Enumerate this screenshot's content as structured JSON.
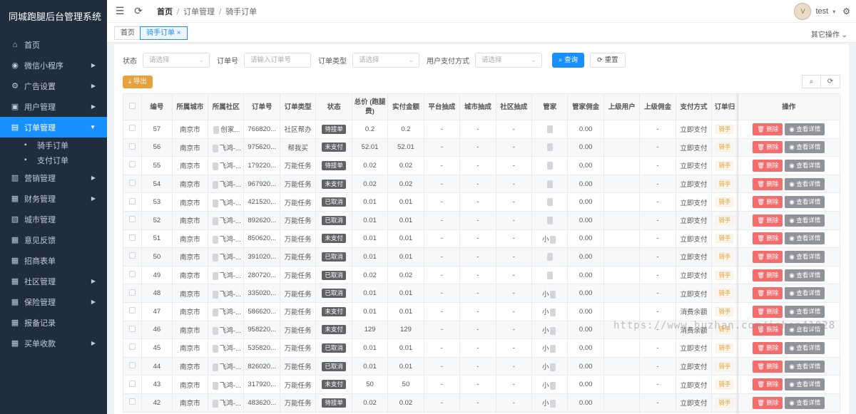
{
  "brand": "同城跑腿后台管理系统",
  "sidebar": {
    "items": [
      {
        "label": "首页",
        "icon": "home-icon",
        "glyph": "⌂",
        "arrow": false
      },
      {
        "label": "微信小程序",
        "icon": "wechat-icon",
        "glyph": "◉",
        "arrow": true
      },
      {
        "label": "广告设置",
        "icon": "ad-settings-icon",
        "glyph": "⚙",
        "arrow": true
      },
      {
        "label": "用户管理",
        "icon": "user-icon",
        "glyph": "▣",
        "arrow": true
      },
      {
        "label": "订单管理",
        "icon": "order-icon",
        "glyph": "▤",
        "arrow": true,
        "active": true
      },
      {
        "label": "骑手订单",
        "icon": "rider-order-icon",
        "glyph": "▪",
        "sub": true
      },
      {
        "label": "支付订单",
        "icon": "pay-order-icon",
        "glyph": "▪",
        "sub": true
      },
      {
        "label": "营销管理",
        "icon": "marketing-icon",
        "glyph": "▥",
        "arrow": true
      },
      {
        "label": "财务管理",
        "icon": "finance-icon",
        "glyph": "▦",
        "arrow": true
      },
      {
        "label": "城市管理",
        "icon": "city-icon",
        "glyph": "▧",
        "arrow": false
      },
      {
        "label": "意见反馈",
        "icon": "feedback-icon",
        "glyph": "▦",
        "arrow": false
      },
      {
        "label": "招商表单",
        "icon": "form-icon",
        "glyph": "▦",
        "arrow": false
      },
      {
        "label": "社区管理",
        "icon": "community-icon",
        "glyph": "▦",
        "arrow": true
      },
      {
        "label": "保险管理",
        "icon": "insurance-icon",
        "glyph": "▦",
        "arrow": true
      },
      {
        "label": "报备记录",
        "icon": "report-icon",
        "glyph": "▦",
        "arrow": false
      },
      {
        "label": "买单收款",
        "icon": "payment-icon",
        "glyph": "▦",
        "arrow": true
      }
    ]
  },
  "topbar": {
    "breadcrumb": [
      "首页",
      "订单管理",
      "骑手订单"
    ],
    "user": "test",
    "avatar_text": "V"
  },
  "tabs": [
    {
      "label": "首页",
      "active": false
    },
    {
      "label": "骑手订单",
      "active": true
    }
  ],
  "other_ops": "其它操作",
  "filters": {
    "status_label": "状态",
    "status_placeholder": "请选择",
    "order_no_label": "订单号",
    "order_no_placeholder": "请输入订单号",
    "order_type_label": "订单类型",
    "order_type_placeholder": "请选择",
    "pay_method_label": "用户支付方式",
    "pay_method_placeholder": "请选择",
    "search_btn": "查询",
    "reset_btn": "重置"
  },
  "export_btn": "导出",
  "table": {
    "headers": [
      "编号",
      "所属城市",
      "所属社区",
      "订单号",
      "订单类型",
      "状态",
      "总价 (跑腿费)",
      "实付金额",
      "平台抽成",
      "城市抽成",
      "社区抽成",
      "管家",
      "管家佣金",
      "上级用户",
      "上级佣金",
      "支付方式",
      "订单归",
      "操作"
    ],
    "del_label": "删除",
    "view_label": "查看详情",
    "rows": [
      {
        "id": "57",
        "city": "南京市",
        "community": "创家...",
        "order_no": "766820...",
        "type": "社区帮办",
        "status": "待接单",
        "total": "0.2",
        "paid": "0.2",
        "platform": "-",
        "city_cut": "-",
        "comm_cut": "-",
        "steward": "",
        "steward_fee": "0.00",
        "parent": "",
        "parent_fee": "-",
        "pay": "立即支付",
        "belong": "骑手"
      },
      {
        "id": "56",
        "city": "南京市",
        "community": "飞鸿-...",
        "order_no": "975620...",
        "type": "帮我买",
        "status": "未支付",
        "total": "52.01",
        "paid": "52.01",
        "platform": "-",
        "city_cut": "-",
        "comm_cut": "-",
        "steward": "",
        "steward_fee": "0.00",
        "parent": "",
        "parent_fee": "-",
        "pay": "立即支付",
        "belong": "骑手"
      },
      {
        "id": "55",
        "city": "南京市",
        "community": "飞鸿-...",
        "order_no": "179220...",
        "type": "万能任务",
        "status": "待接单",
        "total": "0.02",
        "paid": "0.02",
        "platform": "-",
        "city_cut": "-",
        "comm_cut": "-",
        "steward": "",
        "steward_fee": "0.00",
        "parent": "",
        "parent_fee": "-",
        "pay": "立即支付",
        "belong": "骑手"
      },
      {
        "id": "54",
        "city": "南京市",
        "community": "飞鸿-...",
        "order_no": "967920...",
        "type": "万能任务",
        "status": "未支付",
        "total": "0.02",
        "paid": "0.02",
        "platform": "-",
        "city_cut": "-",
        "comm_cut": "-",
        "steward": "",
        "steward_fee": "0.00",
        "parent": "",
        "parent_fee": "-",
        "pay": "立即支付",
        "belong": "骑手"
      },
      {
        "id": "53",
        "city": "南京市",
        "community": "飞鸿-...",
        "order_no": "421520...",
        "type": "万能任务",
        "status": "已取消",
        "total": "0.01",
        "paid": "0.01",
        "platform": "-",
        "city_cut": "-",
        "comm_cut": "-",
        "steward": "",
        "steward_fee": "0.00",
        "parent": "",
        "parent_fee": "-",
        "pay": "立即支付",
        "belong": "骑手"
      },
      {
        "id": "52",
        "city": "南京市",
        "community": "飞鸿-...",
        "order_no": "892620...",
        "type": "万能任务",
        "status": "已取消",
        "total": "0.01",
        "paid": "0.01",
        "platform": "-",
        "city_cut": "-",
        "comm_cut": "-",
        "steward": "",
        "steward_fee": "0.00",
        "parent": "",
        "parent_fee": "-",
        "pay": "立即支付",
        "belong": "骑手"
      },
      {
        "id": "51",
        "city": "南京市",
        "community": "飞鸿-...",
        "order_no": "850620...",
        "type": "万能任务",
        "status": "未支付",
        "total": "0.01",
        "paid": "0.01",
        "platform": "-",
        "city_cut": "-",
        "comm_cut": "-",
        "steward": "小",
        "steward_fee": "0.00",
        "parent": "",
        "parent_fee": "-",
        "pay": "立即支付",
        "belong": "骑手"
      },
      {
        "id": "50",
        "city": "南京市",
        "community": "飞鸿-...",
        "order_no": "391020...",
        "type": "万能任务",
        "status": "已取消",
        "total": "0.01",
        "paid": "0.01",
        "platform": "-",
        "city_cut": "-",
        "comm_cut": "-",
        "steward": "",
        "steward_fee": "0.00",
        "parent": "",
        "parent_fee": "-",
        "pay": "立即支付",
        "belong": "骑手"
      },
      {
        "id": "49",
        "city": "南京市",
        "community": "飞鸿-...",
        "order_no": "280720...",
        "type": "万能任务",
        "status": "已取消",
        "total": "0.02",
        "paid": "0.02",
        "platform": "-",
        "city_cut": "-",
        "comm_cut": "-",
        "steward": "",
        "steward_fee": "0.00",
        "parent": "",
        "parent_fee": "-",
        "pay": "立即支付",
        "belong": "骑手"
      },
      {
        "id": "48",
        "city": "南京市",
        "community": "飞鸿-...",
        "order_no": "335020...",
        "type": "万能任务",
        "status": "已取消",
        "total": "0.01",
        "paid": "0.01",
        "platform": "-",
        "city_cut": "-",
        "comm_cut": "-",
        "steward": "小",
        "steward_fee": "0.00",
        "parent": "",
        "parent_fee": "-",
        "pay": "立即支付",
        "belong": "骑手"
      },
      {
        "id": "47",
        "city": "南京市",
        "community": "飞鸿-...",
        "order_no": "586620...",
        "type": "万能任务",
        "status": "未支付",
        "total": "0.01",
        "paid": "0.01",
        "platform": "-",
        "city_cut": "-",
        "comm_cut": "-",
        "steward": "小",
        "steward_fee": "0.00",
        "parent": "",
        "parent_fee": "-",
        "pay": "消费余额",
        "belong": "骑手"
      },
      {
        "id": "46",
        "city": "南京市",
        "community": "飞鸿-...",
        "order_no": "958220...",
        "type": "万能任务",
        "status": "未支付",
        "total": "129",
        "paid": "129",
        "platform": "-",
        "city_cut": "-",
        "comm_cut": "-",
        "steward": "小",
        "steward_fee": "0.00",
        "parent": "",
        "parent_fee": "-",
        "pay": "消费余额",
        "belong": "骑手"
      },
      {
        "id": "45",
        "city": "南京市",
        "community": "飞鸿-...",
        "order_no": "535820...",
        "type": "万能任务",
        "status": "已取消",
        "total": "0.01",
        "paid": "0.01",
        "platform": "-",
        "city_cut": "-",
        "comm_cut": "-",
        "steward": "小",
        "steward_fee": "0.00",
        "parent": "",
        "parent_fee": "-",
        "pay": "立即支付",
        "belong": "骑手"
      },
      {
        "id": "44",
        "city": "南京市",
        "community": "飞鸿-...",
        "order_no": "826020...",
        "type": "万能任务",
        "status": "已取消",
        "total": "0.01",
        "paid": "0.01",
        "platform": "-",
        "city_cut": "-",
        "comm_cut": "-",
        "steward": "小",
        "steward_fee": "0.00",
        "parent": "",
        "parent_fee": "-",
        "pay": "立即支付",
        "belong": "骑手"
      },
      {
        "id": "43",
        "city": "南京市",
        "community": "飞鸿-...",
        "order_no": "317920...",
        "type": "万能任务",
        "status": "未支付",
        "total": "50",
        "paid": "50",
        "platform": "-",
        "city_cut": "-",
        "comm_cut": "-",
        "steward": "小",
        "steward_fee": "0.00",
        "parent": "",
        "parent_fee": "-",
        "pay": "立即支付",
        "belong": "骑手"
      },
      {
        "id": "42",
        "city": "南京市",
        "community": "飞鸿-...",
        "order_no": "483620...",
        "type": "万能任务",
        "status": "待接单",
        "total": "0.02",
        "paid": "0.02",
        "platform": "-",
        "city_cut": "-",
        "comm_cut": "-",
        "steward": "小",
        "steward_fee": "0.00",
        "parent": "",
        "parent_fee": "-",
        "pay": "立即支付",
        "belong": "骑手"
      }
    ]
  },
  "watermark": "https://www.huzhan.com/ishop41028"
}
